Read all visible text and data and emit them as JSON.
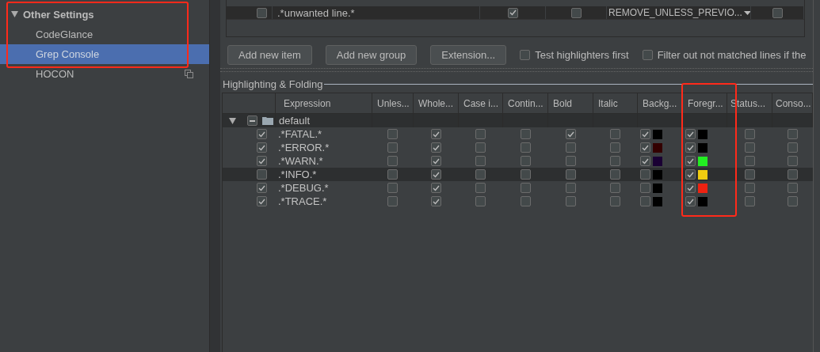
{
  "sidebar": {
    "group": {
      "label": "Other Settings",
      "expanded": true
    },
    "items": [
      {
        "label": "CodeGlance",
        "selected": false,
        "kind": "plain"
      },
      {
        "label": "Grep Console",
        "selected": true,
        "kind": "plain"
      },
      {
        "label": "HOCON",
        "selected": false,
        "kind": "project"
      }
    ]
  },
  "filter_table": {
    "rows": [
      {
        "enabled": false,
        "expression": ".*unwanted line.*",
        "column_3": true,
        "column_4": false,
        "action": "REMOVE_UNLESS_PREVIO...",
        "column_6": false
      }
    ]
  },
  "buttons": [
    "Add new item",
    "Add new group",
    "Extension..."
  ],
  "options": [
    {
      "label": "Test highlighters first",
      "checked": false
    },
    {
      "label": "Filter out not matched lines if the",
      "checked": false
    }
  ],
  "highlighting": {
    "title": "Highlighting & Folding",
    "columns": [
      "Expression",
      "Unles...",
      "Whole...",
      "Case i...",
      "Contin...",
      "Bold",
      "Italic",
      "Backg...",
      "Foregr...",
      "Status...",
      "Conso..."
    ],
    "group": {
      "name": "default",
      "expanded": true,
      "mixed": true
    },
    "rows": [
      {
        "enabled": true,
        "expression": ".*FATAL.*",
        "unless": false,
        "whole": true,
        "case": false,
        "continue": false,
        "bold": true,
        "italic": false,
        "background": {
          "checked": true,
          "color": "#000000"
        },
        "foreground": {
          "checked": true,
          "color": "#000000"
        },
        "status": false,
        "console": false,
        "selected": false
      },
      {
        "enabled": true,
        "expression": ".*ERROR.*",
        "unless": false,
        "whole": true,
        "case": false,
        "continue": false,
        "bold": false,
        "italic": false,
        "background": {
          "checked": true,
          "color": "#330000"
        },
        "foreground": {
          "checked": true,
          "color": "#000000"
        },
        "status": false,
        "console": false,
        "selected": false
      },
      {
        "enabled": true,
        "expression": ".*WARN.*",
        "unless": false,
        "whole": true,
        "case": false,
        "continue": false,
        "bold": false,
        "italic": false,
        "background": {
          "checked": true,
          "color": "#1a0033"
        },
        "foreground": {
          "checked": true,
          "color": "#22ee22"
        },
        "status": false,
        "console": false,
        "selected": false
      },
      {
        "enabled": false,
        "expression": ".*INFO.*",
        "unless": false,
        "whole": true,
        "case": false,
        "continue": false,
        "bold": false,
        "italic": false,
        "background": {
          "checked": false,
          "color": "#000000"
        },
        "foreground": {
          "checked": true,
          "color": "#f0cc10"
        },
        "status": false,
        "console": false,
        "selected": true
      },
      {
        "enabled": true,
        "expression": ".*DEBUG.*",
        "unless": false,
        "whole": true,
        "case": false,
        "continue": false,
        "bold": false,
        "italic": false,
        "background": {
          "checked": false,
          "color": "#000000"
        },
        "foreground": {
          "checked": true,
          "color": "#ee2211"
        },
        "status": false,
        "console": false,
        "selected": false
      },
      {
        "enabled": true,
        "expression": ".*TRACE.*",
        "unless": false,
        "whole": true,
        "case": false,
        "continue": false,
        "bold": false,
        "italic": false,
        "background": {
          "checked": false,
          "color": "#000000"
        },
        "foreground": {
          "checked": true,
          "color": "#000000"
        },
        "status": false,
        "console": false,
        "selected": false
      }
    ]
  }
}
